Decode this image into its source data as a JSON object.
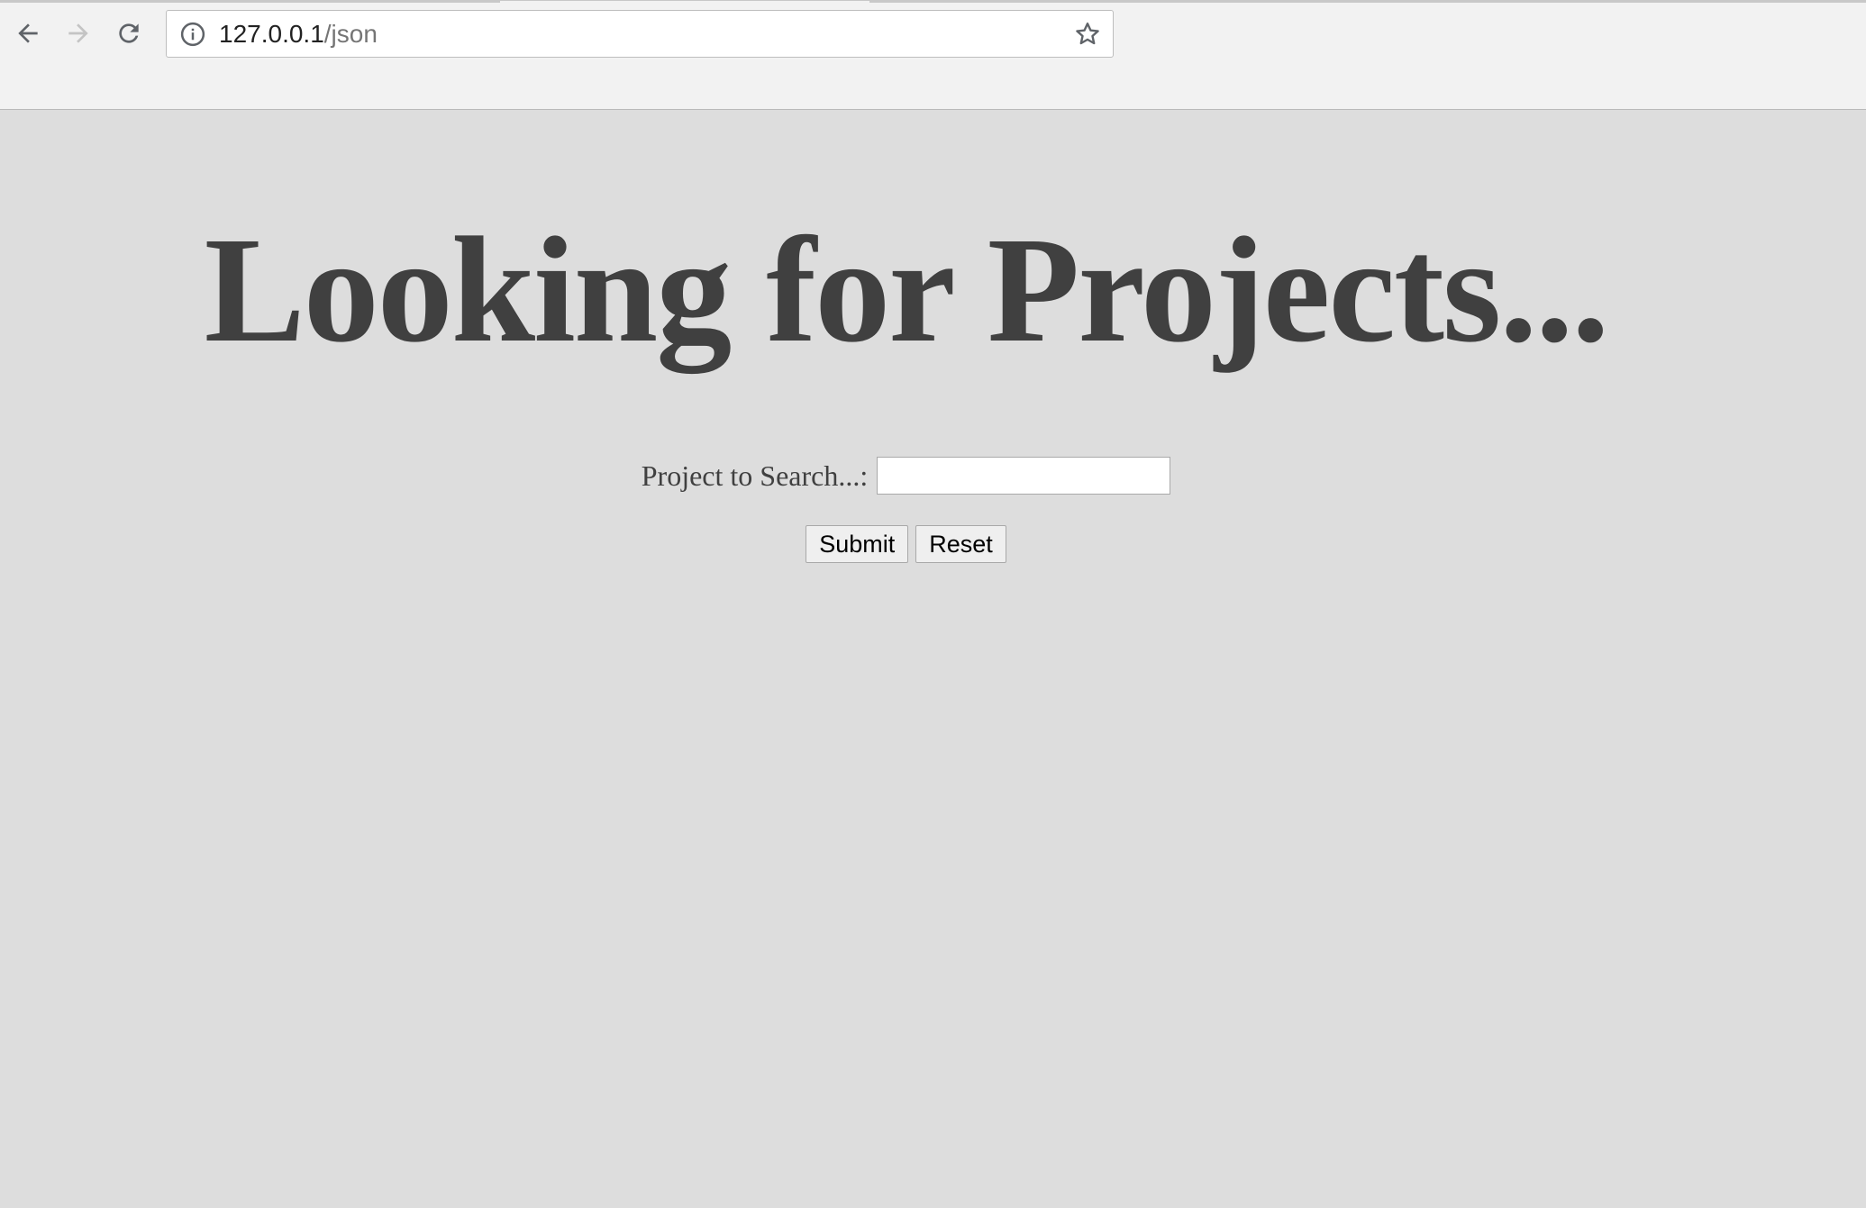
{
  "browser": {
    "url_host": "127.0.0.1",
    "url_path": "/json",
    "icons": {
      "back": "back-arrow-icon",
      "forward": "forward-arrow-icon",
      "reload": "reload-icon",
      "info": "info-icon",
      "bookmark": "star-icon"
    }
  },
  "page": {
    "title": "Looking for Projects...",
    "search_label": "Project to Search...:",
    "search_value": "",
    "submit_label": "Submit",
    "reset_label": "Reset"
  },
  "colors": {
    "page_background": "#dddddd",
    "title_text": "#404040",
    "toolbar_background": "#f2f2f2"
  }
}
